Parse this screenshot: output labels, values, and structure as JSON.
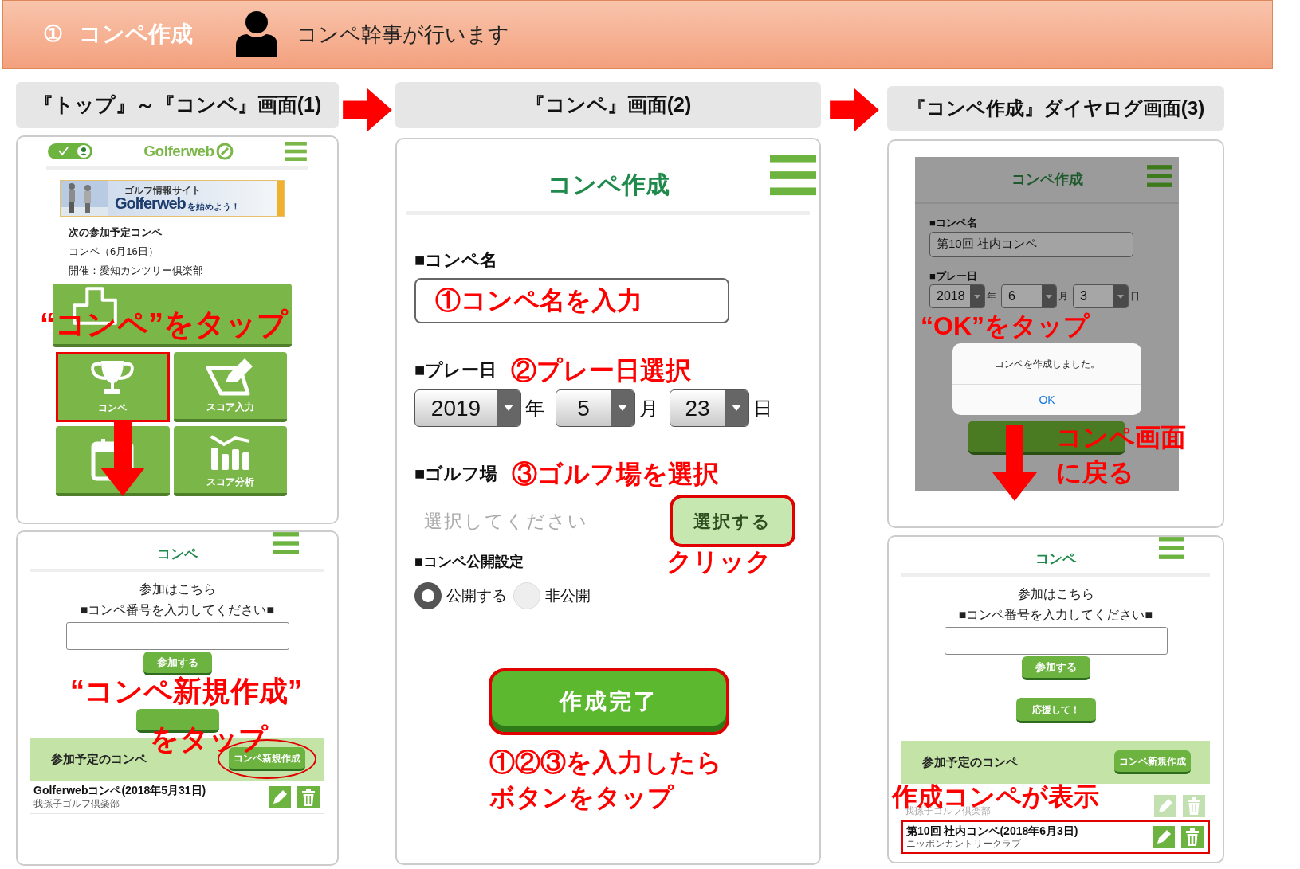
{
  "header": {
    "step": "①",
    "title": "コンペ作成",
    "note": "コンペ幹事が行います"
  },
  "steps": [
    {
      "label": "『トップ』～『コンペ』画面(1)"
    },
    {
      "label": "『コンペ』画面(2)"
    },
    {
      "label": "『コンペ作成』ダイヤログ画面(3)"
    }
  ],
  "top_screen": {
    "toggle_on": true,
    "logo": "Golferweb",
    "banner": {
      "tagline": "ゴルフ情報サイト",
      "brand": "Golferweb",
      "call": "を始めよう！"
    },
    "next_heading": "次の参加予定コンペ",
    "next_event": "コンペ（6月16日）",
    "next_venue": "開催：愛知カンツリー倶楽部",
    "tiles": [
      {
        "kind": "trophy",
        "label": "コンペ",
        "highlighted": true
      },
      {
        "kind": "scorecard",
        "label": "スコア入力",
        "highlighted": false
      },
      {
        "kind": "calendar",
        "highlighted": false
      },
      {
        "kind": "chart",
        "label": "スコア分析",
        "highlighted": false
      }
    ],
    "annotation": "“コンペ”をタップ"
  },
  "compe_screen": {
    "title": "コンペ",
    "join_heading": "参加はこちら",
    "join_prompt": "■コンペ番号を入力してください■",
    "join_button": "参加する",
    "section_title": "参加予定のコンペ",
    "new_button": {
      "label": "コンペ新規作成",
      "circled": true
    },
    "entries": [
      {
        "name": "Golferwebコンペ(2018年5月31日)",
        "course": "我孫子ゴルフ倶楽部",
        "faded": false,
        "highlighted": false
      }
    ],
    "annotation": [
      "“コンペ新規作成”",
      "をタップ"
    ]
  },
  "create_screen": {
    "title": "コンペ作成",
    "name_label": "■コンペ名",
    "name_annotation": "①コンペ名を入力",
    "date_label": "■プレー日",
    "date_annotation": "②プレー日選択",
    "date_fields": [
      {
        "value": "2019",
        "unit": "年"
      },
      {
        "value": "5",
        "unit": "月"
      },
      {
        "value": "23",
        "unit": "日"
      }
    ],
    "course_label": "■ゴルフ場",
    "course_annotation": "③ゴルフ場を選択",
    "course_placeholder": "選択してください",
    "course_button": "選択する",
    "click_annotation": "クリック",
    "visibility_label": "■コンペ公開設定",
    "visibility_options": [
      {
        "label": "公開する",
        "selected": true
      },
      {
        "label": "非公開",
        "selected": false
      }
    ],
    "submit_button": "作成完了",
    "submit_annotation": [
      "①②③を入力したら",
      "ボタンをタップ"
    ]
  },
  "dialog_screen": {
    "title": "コンペ作成",
    "name_label": "■コンペ名",
    "name_value": "第10回 社内コンペ",
    "date_label": "■プレー日",
    "date_fields": [
      {
        "value": "2018",
        "unit": "年"
      },
      {
        "value": "6",
        "unit": "月"
      },
      {
        "value": "3",
        "unit": "日"
      }
    ],
    "alert": {
      "message": "コンペを作成しました。",
      "button": "OK"
    },
    "ok_annotation": "“OK”をタップ",
    "return_annotation": [
      "コンペ画面",
      "に戻る"
    ]
  },
  "result_screen": {
    "title": "コンペ",
    "join_heading": "参加はこちら",
    "join_prompt": "■コンペ番号を入力してください■",
    "join_button": "参加する",
    "cheer_button": "応援して！",
    "section_title": "参加予定のコンペ",
    "new_button": {
      "label": "コンペ新規作成",
      "circled": false
    },
    "entries": [
      {
        "course": "我孫子ゴルフ倶楽部",
        "faded": true,
        "highlighted": false
      },
      {
        "name": "第10回 社内コンペ(2018年6月3日)",
        "course": "ニッポンカントリークラブ",
        "faded": false,
        "highlighted": true
      }
    ],
    "annotation": "作成コンペが表示"
  }
}
